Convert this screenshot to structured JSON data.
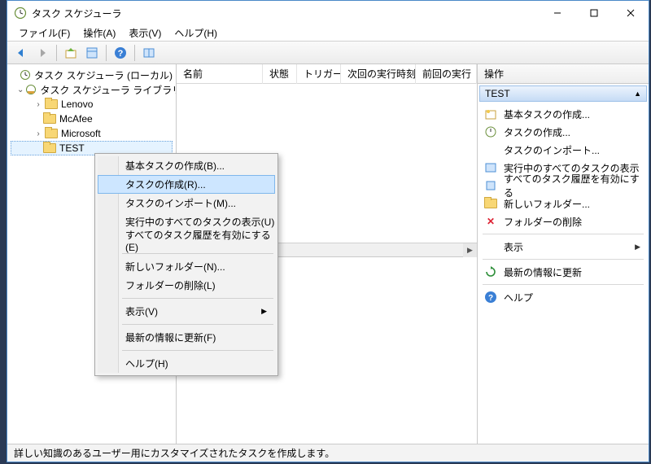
{
  "title": "タスク スケジューラ",
  "menubar": [
    "ファイル(F)",
    "操作(A)",
    "表示(V)",
    "ヘルプ(H)"
  ],
  "tree": {
    "root": "タスク スケジューラ (ローカル)",
    "lib": "タスク スケジューラ ライブラリ",
    "items": [
      "Lenovo",
      "McAfee",
      "Microsoft",
      "TEST"
    ]
  },
  "list_headers": [
    "名前",
    "状態",
    "トリガー",
    "次回の実行時刻",
    "前回の実行"
  ],
  "context_menu": [
    "基本タスクの作成(B)...",
    "タスクの作成(R)...",
    "タスクのインポート(M)...",
    "実行中のすべてのタスクの表示(U)",
    "すべてのタスク履歴を有効にする(E)",
    "新しいフォルダー(N)...",
    "フォルダーの削除(L)",
    "表示(V)",
    "最新の情報に更新(F)",
    "ヘルプ(H)"
  ],
  "actions": {
    "header": "操作",
    "subheader": "TEST",
    "items": [
      "基本タスクの作成...",
      "タスクの作成...",
      "タスクのインポート...",
      "実行中のすべてのタスクの表示",
      "すべてのタスク履歴を有効にする",
      "新しいフォルダー...",
      "フォルダーの削除",
      "表示",
      "最新の情報に更新",
      "ヘルプ"
    ]
  },
  "status": "詳しい知識のあるユーザー用にカスタマイズされたタスクを作成します。"
}
